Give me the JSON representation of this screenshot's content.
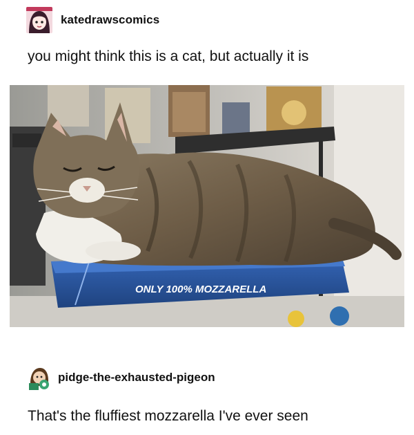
{
  "post": {
    "author": {
      "username": "katedrawscomics",
      "avatar_icon": "avatar-icon"
    },
    "text": "you might think this is a cat, but actually it is",
    "image": {
      "box_label": "ONLY 100% MOZZARELLA",
      "colors": {
        "box_blue": "#2b57a6",
        "wall": "#dedad4",
        "shelf": "#3a3a3a"
      }
    }
  },
  "reply": {
    "author": {
      "username": "pidge-the-exhausted-pigeon",
      "avatar_icon": "avatar-icon"
    },
    "text": "That's the fluffiest mozzarella I've ever seen"
  }
}
